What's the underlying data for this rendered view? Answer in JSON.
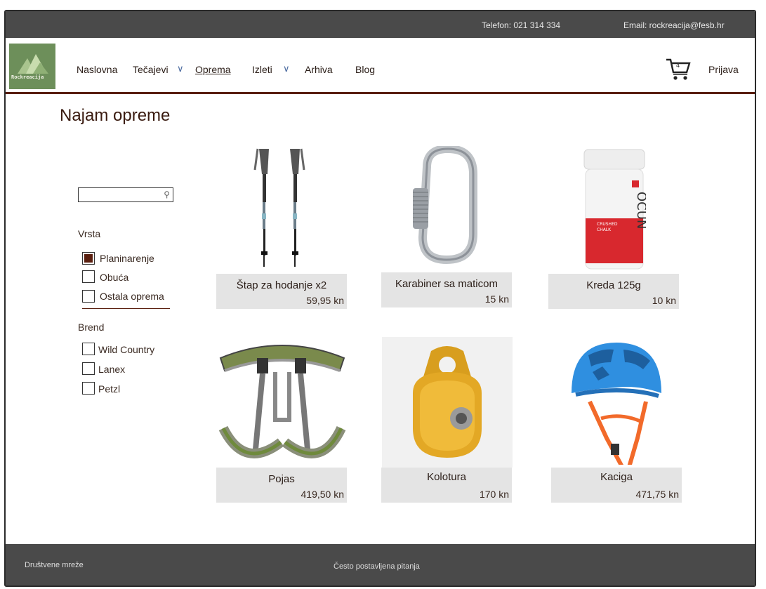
{
  "topbar": {
    "phone": "Telefon: 021 314 334",
    "email": "Email: rockreacija@fesb.hr"
  },
  "logo": {
    "text": "Rockreacija"
  },
  "nav": {
    "items": [
      {
        "label": "Naslovna"
      },
      {
        "label": "Tečajevi"
      },
      {
        "label": "Oprema"
      },
      {
        "label": "Izleti"
      },
      {
        "label": "Arhiva"
      },
      {
        "label": "Blog"
      }
    ],
    "active": "Oprema",
    "cart_count": "4",
    "login": "Prijava"
  },
  "page": {
    "title": "Najam opreme"
  },
  "search": {
    "placeholder": "",
    "value": ""
  },
  "filters": {
    "type": {
      "heading": "Vrsta",
      "options": [
        {
          "label": "Planinarenje",
          "checked": true
        },
        {
          "label": "Obuća",
          "checked": false
        },
        {
          "label": "Ostala oprema",
          "checked": false
        }
      ]
    },
    "brand": {
      "heading": "Brend",
      "options": [
        {
          "label": "Wild Country",
          "checked": false
        },
        {
          "label": "Lanex",
          "checked": false
        },
        {
          "label": "Petzl",
          "checked": false
        }
      ]
    }
  },
  "products": [
    {
      "name": "Štap za hodanje x2",
      "price": "59,95 kn",
      "image": "trekking-poles-image"
    },
    {
      "name": "Karabiner sa maticom",
      "price": "15 kn",
      "image": "carabiner-image"
    },
    {
      "name": "Kreda 125g",
      "price": "10 kn",
      "image": "chalk-jar-image"
    },
    {
      "name": "Pojas",
      "price": "419,50 kn",
      "image": "harness-image"
    },
    {
      "name": "Kolotura",
      "price": "170 kn",
      "image": "pulley-image"
    },
    {
      "name": "Kaciga",
      "price": "471,75 kn",
      "image": "helmet-image"
    }
  ],
  "footer": {
    "social": "Društvene mreže",
    "faq": "Često postavljena pitanja"
  },
  "colors": {
    "accent": "#5a1f0f",
    "topbar": "#4a4a4a",
    "card": "#e4e4e4",
    "logo": "#6d8f5a"
  }
}
